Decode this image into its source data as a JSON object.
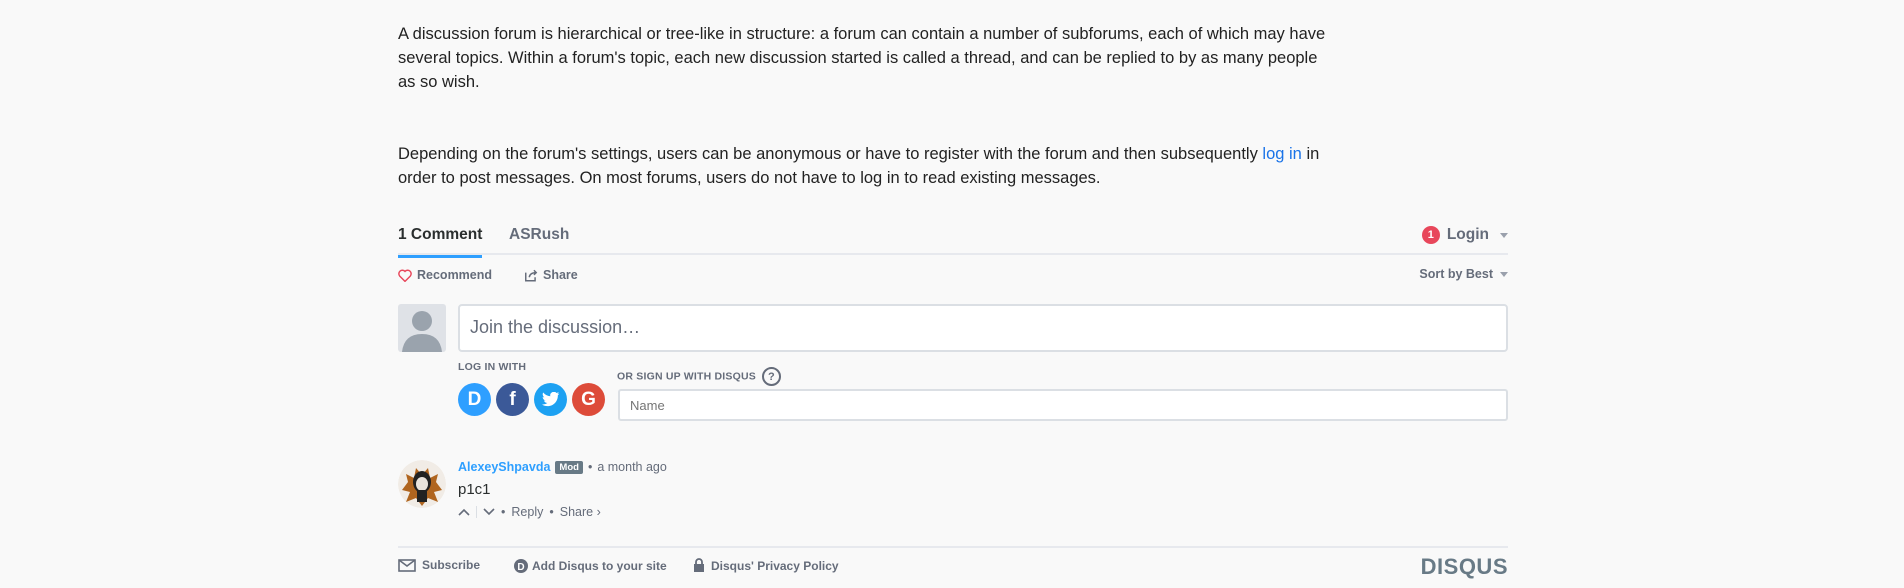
{
  "article": {
    "p1": "A discussion forum is hierarchical or tree-like in structure: a forum can contain a number of subforums, each of which may have several topics. Within a forum's topic, each new discussion started is called a thread, and can be replied to by as many people as so wish.",
    "p2_before": "Depending on the forum's settings, users can be anonymous or have to register with the forum and then subsequently ",
    "p2_link": "log in",
    "p2_after": " in order to post messages. On most forums, users do not have to log in to read existing messages."
  },
  "disqus": {
    "tabs": {
      "comments": "1 Comment",
      "community": "ASRush"
    },
    "login": {
      "badge": "1",
      "label": "Login"
    },
    "actions": {
      "recommend": "Recommend",
      "share": "Share",
      "sort": "Sort by Best"
    },
    "composer": {
      "placeholder": "Join the discussion…",
      "login_with": "LOG IN WITH",
      "signup": "OR SIGN UP WITH DISQUS",
      "help": "?",
      "name_placeholder": "Name",
      "social": [
        "D",
        "f",
        "t",
        "G"
      ]
    },
    "comment": {
      "author": "AlexeyShpavda",
      "badge": "Mod",
      "time": "a month ago",
      "body": "p1c1",
      "reply": "Reply",
      "share": "Share ›"
    },
    "footer": {
      "subscribe": "Subscribe",
      "add": "Add Disqus to your site",
      "privacy": "Disqus' Privacy Policy",
      "logo": "DISQUS"
    },
    "colors": {
      "accent": "#2e9fff",
      "link": "#1a73e8",
      "notif": "#e8475b"
    }
  }
}
